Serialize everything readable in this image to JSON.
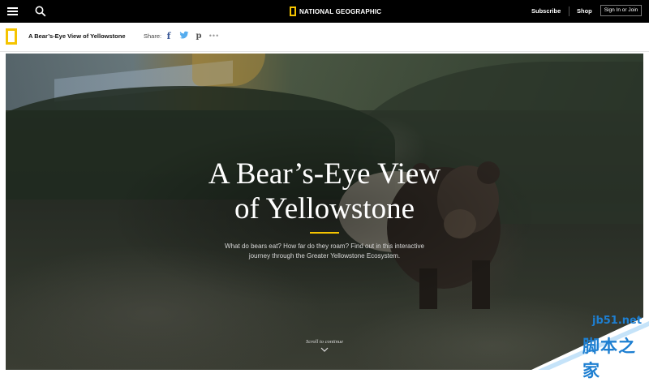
{
  "topbar": {
    "brand": "NATIONAL GEOGRAPHIC",
    "subscribe_label": "Subscribe",
    "shop_label": "Shop",
    "signin_label": "Sign In or Join",
    "icons": [
      "hamburger-menu-icon",
      "search-icon",
      "nat-geo-logo"
    ]
  },
  "subbar": {
    "article_title": "A Bear’s-Eye View of Yellowstone",
    "share_label": "Share:",
    "share_icons": [
      "facebook-icon",
      "twitter-icon",
      "pinterest-icon",
      "more-icon"
    ]
  },
  "hero": {
    "title": "A Bear’s-Eye View\nof Yellowstone",
    "description": "What do bears eat? How far do they roam? Find out in this interactive\njourney through the Greater Yellowstone Ecosystem.",
    "scroll_label": "Scroll to continue"
  },
  "watermark": {
    "line1": "jb51.net",
    "line2": "脚本之家"
  },
  "colors": {
    "accent": "#f5c400",
    "topbar": "#000000",
    "watermark": "#1e7fd1"
  }
}
